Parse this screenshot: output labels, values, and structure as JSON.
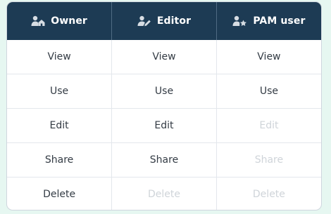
{
  "columns": [
    {
      "label": "Owner",
      "icon": "user-home-icon"
    },
    {
      "label": "Editor",
      "icon": "user-edit-icon"
    },
    {
      "label": "PAM user",
      "icon": "user-star-icon"
    }
  ],
  "rows": [
    {
      "permission": "View",
      "cells": [
        {
          "text": "View",
          "enabled": true
        },
        {
          "text": "View",
          "enabled": true
        },
        {
          "text": "View",
          "enabled": true
        }
      ]
    },
    {
      "permission": "Use",
      "cells": [
        {
          "text": "Use",
          "enabled": true
        },
        {
          "text": "Use",
          "enabled": true
        },
        {
          "text": "Use",
          "enabled": true
        }
      ]
    },
    {
      "permission": "Edit",
      "cells": [
        {
          "text": "Edit",
          "enabled": true
        },
        {
          "text": "Edit",
          "enabled": true
        },
        {
          "text": "Edit",
          "enabled": false
        }
      ]
    },
    {
      "permission": "Share",
      "cells": [
        {
          "text": "Share",
          "enabled": true
        },
        {
          "text": "Share",
          "enabled": true
        },
        {
          "text": "Share",
          "enabled": false
        }
      ]
    },
    {
      "permission": "Delete",
      "cells": [
        {
          "text": "Delete",
          "enabled": true
        },
        {
          "text": "Delete",
          "enabled": false
        },
        {
          "text": "Delete",
          "enabled": false
        }
      ]
    }
  ],
  "colors": {
    "header_bg": "#1d3b54",
    "header_icon": "#d7dde3",
    "enabled_text": "#333b44",
    "disabled_text": "#cfd4d9",
    "page_bg": "#e6f7f1"
  }
}
